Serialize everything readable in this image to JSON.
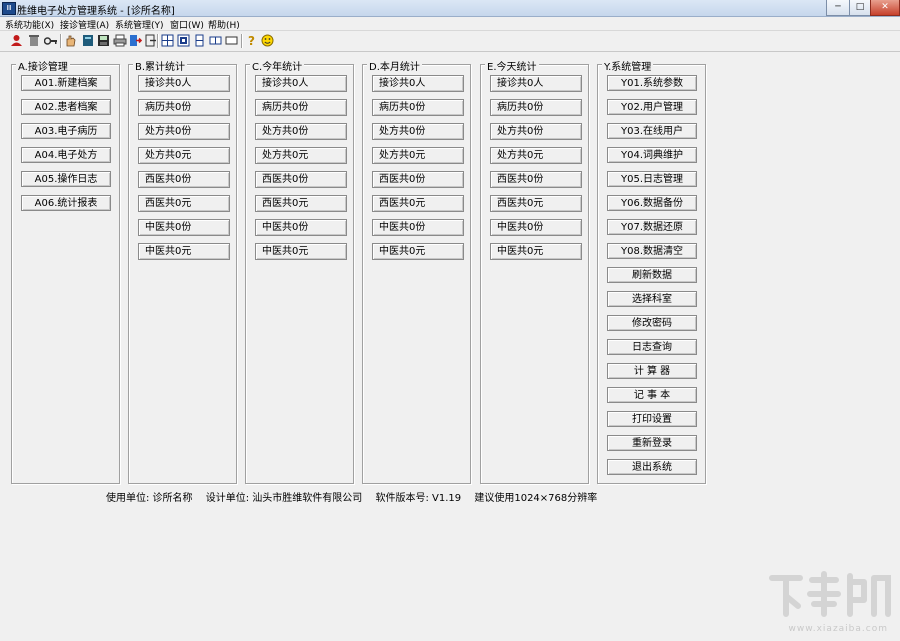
{
  "window": {
    "icon_text": "Ⅲ",
    "title": "胜维电子处方管理系统 - [诊所名称]",
    "min_glyph": "─",
    "max_glyph": "□",
    "close_glyph": "✕"
  },
  "menu": [
    {
      "label": "系统功能(X)"
    },
    {
      "label": "接诊管理(A)"
    },
    {
      "label": "系统管理(Y)"
    },
    {
      "label": "窗口(W)"
    },
    {
      "label": "帮助(H)"
    }
  ],
  "toolbar": {
    "icons": [
      "user-red-icon",
      "trash-icon",
      "key-icon",
      "hand-icon",
      "book-icon",
      "disk-icon",
      "printer-icon",
      "logout-icon",
      "exit-door-icon",
      "tile-icon",
      "cascade-icon",
      "tile-vertical-icon",
      "tile-horizontal-icon",
      "restore-icon",
      "help-icon",
      "smiley-icon"
    ]
  },
  "groups": {
    "a": {
      "title": "A.接诊管理",
      "items": [
        "A01.新建档案",
        "A02.患者档案",
        "A03.电子病历",
        "A04.电子处方",
        "A05.操作日志",
        "A06.统计报表"
      ]
    },
    "b": {
      "title": "B.累计统计",
      "items": [
        "接诊共0人",
        "病历共0份",
        "处方共0份",
        "处方共0元",
        "西医共0份",
        "西医共0元",
        "中医共0份",
        "中医共0元"
      ]
    },
    "c": {
      "title": "C.今年统计",
      "items": [
        "接诊共0人",
        "病历共0份",
        "处方共0份",
        "处方共0元",
        "西医共0份",
        "西医共0元",
        "中医共0份",
        "中医共0元"
      ]
    },
    "d": {
      "title": "D.本月统计",
      "items": [
        "接诊共0人",
        "病历共0份",
        "处方共0份",
        "处方共0元",
        "西医共0份",
        "西医共0元",
        "中医共0份",
        "中医共0元"
      ]
    },
    "e": {
      "title": "E.今天统计",
      "items": [
        "接诊共0人",
        "病历共0份",
        "处方共0份",
        "处方共0元",
        "西医共0份",
        "西医共0元",
        "中医共0份",
        "中医共0元"
      ]
    },
    "y": {
      "title": "Y.系统管理",
      "items": [
        "Y01.系统参数",
        "Y02.用户管理",
        "Y03.在线用户",
        "Y04.词典维护",
        "Y05.日志管理",
        "Y06.数据备份",
        "Y07.数据还原",
        "Y08.数据清空",
        "刷新数据",
        "选择科室",
        "修改密码",
        "日志查询",
        "计 算 器",
        "记 事 本",
        "打印设置",
        "重新登录",
        "退出系统"
      ]
    }
  },
  "footer": {
    "unit": "使用单位: 诊所名称",
    "designer": "设计单位: 汕头市胜维软件有限公司",
    "version": "软件版本号: V1.19",
    "resolution": "建议使用1024×768分辨率"
  },
  "watermark": {
    "text": "www.xiazaiba.com"
  }
}
